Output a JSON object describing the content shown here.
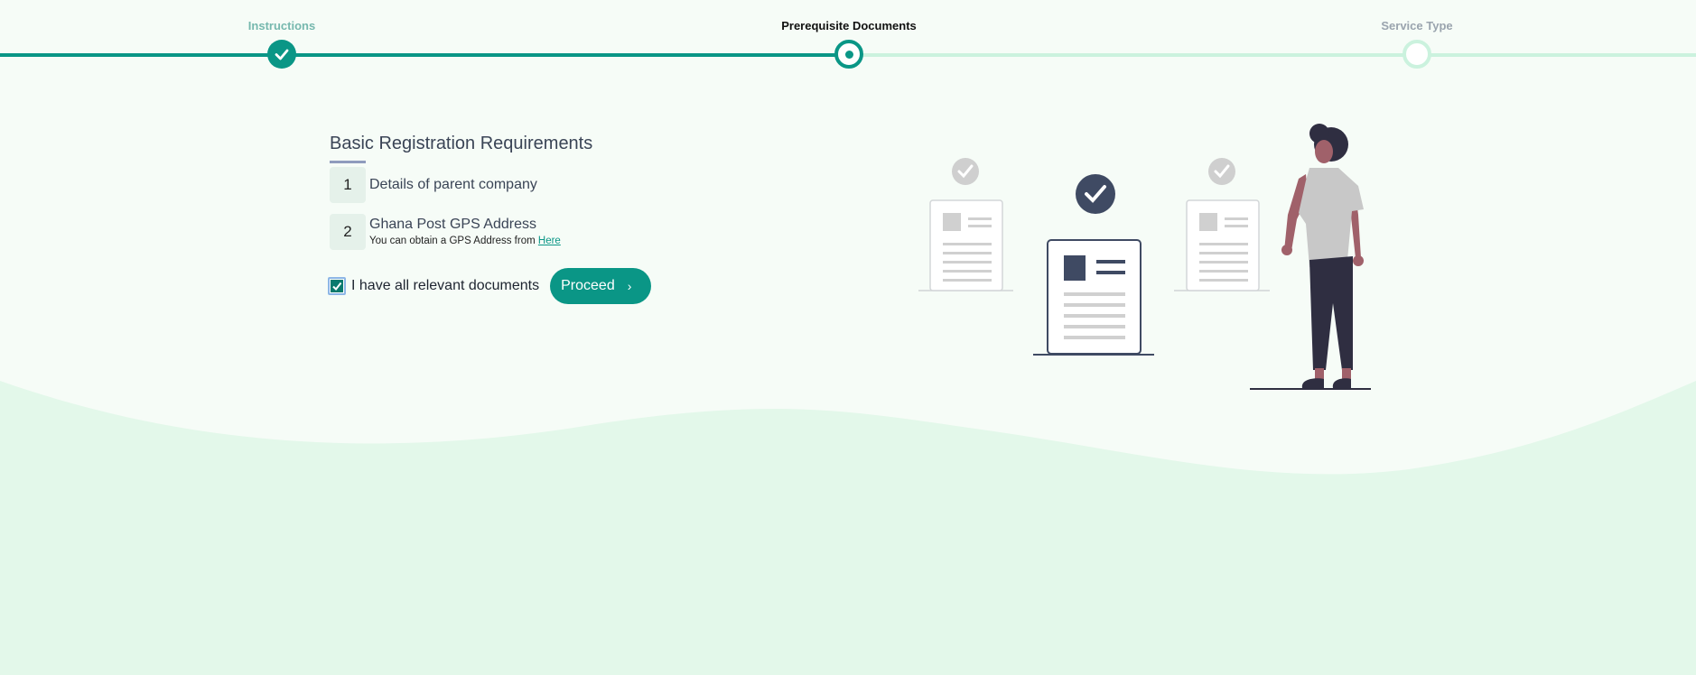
{
  "stepper": {
    "steps": [
      {
        "label": "Instructions",
        "state": "done"
      },
      {
        "label": "Prerequisite Documents",
        "state": "current"
      },
      {
        "label": "Service Type",
        "state": "todo"
      }
    ]
  },
  "requirements": {
    "title": "Basic Registration Requirements",
    "items": [
      {
        "number": "1",
        "text": "Details of parent company"
      },
      {
        "number": "2",
        "text": "Ghana Post GPS Address",
        "subtext": "You can obtain a GPS Address from",
        "link": "Here"
      }
    ]
  },
  "confirm": {
    "label": "I have all relevant documents",
    "checked": true
  },
  "actions": {
    "proceed_label": "Proceed",
    "proceed_icon": "chevron-right-icon"
  },
  "colors": {
    "accent": "#0a9686",
    "light_track": "#cbf2de",
    "wave": "#e3f8ea",
    "background": "#f6fcf7"
  }
}
